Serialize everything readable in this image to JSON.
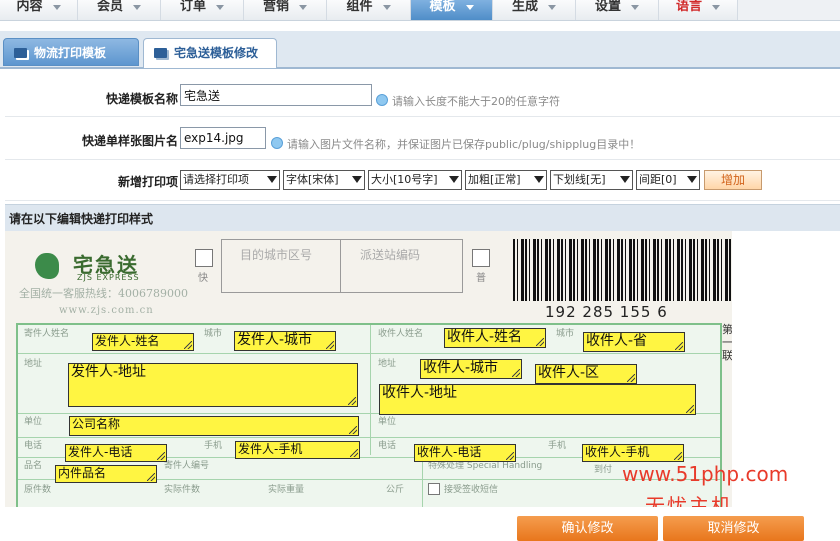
{
  "nav": {
    "items": [
      {
        "label": "内容"
      },
      {
        "label": "会员"
      },
      {
        "label": "订单"
      },
      {
        "label": "营销"
      },
      {
        "label": "组件"
      },
      {
        "label": "模板"
      },
      {
        "label": "生成"
      },
      {
        "label": "设置"
      },
      {
        "label": "语言"
      }
    ],
    "active": "模板"
  },
  "tabs": [
    {
      "label": "物流打印模板"
    },
    {
      "label": "宅急送模板修改"
    }
  ],
  "form": {
    "name_label": "快递模板名称",
    "name_value": "宅急送",
    "name_hint": "请输入长度不能大于20的任意字符",
    "image_label": "快递单样张图片名",
    "image_value": "exp14.jpg",
    "image_hint": "请输入图片文件名称，并保证图片已保存public/plug/shipplug目录中！",
    "add_label": "新增打印项",
    "selects": [
      "请选择打印项",
      "字体[宋体]",
      "大小[10号字]",
      "加粗[正常]",
      "下划线[无]",
      "间距[0]"
    ],
    "add_button": "增加"
  },
  "section": {
    "title": "请在以下编辑快递打印样式"
  },
  "waybill": {
    "logo_cn": "宅急送",
    "logo_en": "ZJS EXPRESS",
    "hotline": "全国统一客服热线：4006789000",
    "website": "www.zjs.com.cn",
    "express_label": "快",
    "normal_label": "普",
    "dest_label": "目的城市区号",
    "station_label": "派送站编码",
    "barcode_number": "192 285 155 6",
    "side_label": "第一联",
    "field_labels": {
      "sender_name": "寄件人姓名",
      "sender_city": "城市",
      "recipient_name": "收件人姓名",
      "recipient_city": "城市",
      "address": "地址",
      "unit": "单位",
      "phone": "电话",
      "mobile": "手机",
      "goods": "品名",
      "sender_no": "寄件人编号",
      "special": "特殊处理 Special Handling",
      "receipt": "接受签收短信",
      "actual_weight": "实际件数",
      "weight": "实际重量",
      "public": "公斤",
      "original": "原件数",
      "to_time": "到付"
    },
    "print_fields": [
      "发件人-姓名",
      "发件人-城市",
      "收件人-姓名",
      "收件人-省",
      "发件人-地址",
      "收件人-城市",
      "收件人-区",
      "收件人-地址",
      "公司名称",
      "发件人-电话",
      "发件人-手机",
      "收件人-电话",
      "收件人-手机",
      "内件品名"
    ]
  },
  "watermark": {
    "line1": "www.51php.com",
    "line2": "无忧主机"
  },
  "buttons": {
    "confirm": "确认修改",
    "cancel": "取消修改"
  }
}
